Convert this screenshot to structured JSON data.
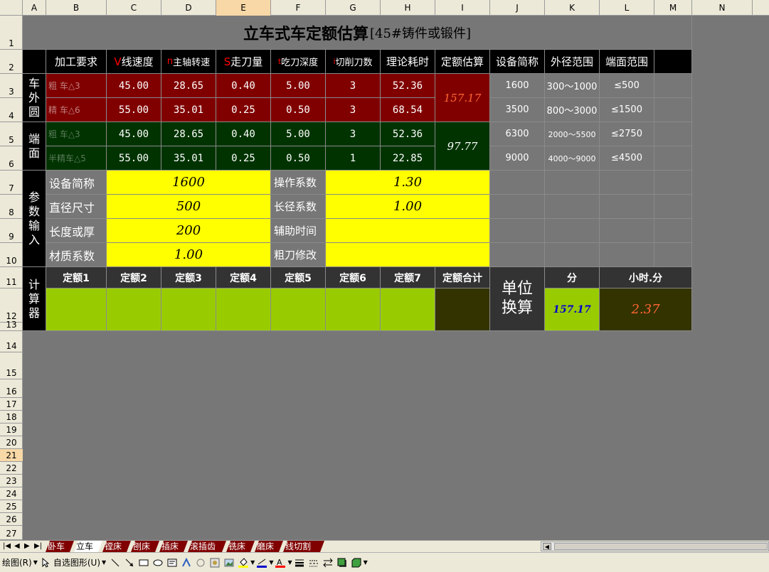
{
  "columns": [
    "A",
    "B",
    "C",
    "D",
    "E",
    "F",
    "G",
    "H",
    "I",
    "J",
    "K",
    "L",
    "M",
    "N"
  ],
  "rows": [
    "1",
    "2",
    "3",
    "4",
    "5",
    "6",
    "7",
    "8",
    "9",
    "10",
    "11",
    "12",
    "13",
    "14",
    "15",
    "16",
    "17",
    "18",
    "19",
    "20",
    "21",
    "22",
    "23",
    "24",
    "25",
    "26",
    "27"
  ],
  "selected_column": "E",
  "selected_row": "21",
  "title": {
    "main": "立车式车定额估算",
    "bracket": "[45#铸件或锻件]"
  },
  "headers": {
    "jiagong": "加工要求",
    "v_prefix": "V",
    "v_rest": "线速度",
    "n_prefix": "n",
    "n_rest": "主轴转速",
    "s_prefix": "S",
    "s_rest": "走刀量",
    "t_prefix": "t",
    "t_rest": "吃刀深度",
    "i_prefix": "i",
    "i_rest": "切削刀数",
    "lilun": "理论耗时",
    "dinge": "定额估算",
    "shebei": "设备简称",
    "waijing": "外径范围",
    "duanmian": "端面范围"
  },
  "section_labels": {
    "outer": [
      "车",
      "外",
      "圆"
    ],
    "face": [
      "端",
      "面"
    ],
    "params": [
      "参",
      "数",
      "输",
      "入"
    ],
    "calc": [
      "计",
      "算",
      "器"
    ]
  },
  "outer_rows": [
    {
      "label": "粗    车△3",
      "v": "45.00",
      "n": "28.65",
      "s": "0.40",
      "t": "5.00",
      "i": "3",
      "time": "52.36"
    },
    {
      "label": "精    车△6",
      "v": "55.00",
      "n": "35.01",
      "s": "0.25",
      "t": "0.50",
      "i": "3",
      "time": "68.54"
    }
  ],
  "outer_estimate": "157.17",
  "face_rows": [
    {
      "label": "粗    车△3",
      "v": "45.00",
      "n": "28.65",
      "s": "0.40",
      "t": "5.00",
      "i": "3",
      "time": "52.36"
    },
    {
      "label": "半精车△5",
      "v": "55.00",
      "n": "35.01",
      "s": "0.25",
      "t": "0.50",
      "i": "1",
      "time": "22.85"
    }
  ],
  "face_estimate": "97.77",
  "equipment_table": [
    {
      "code": "1600",
      "outer": "300～1000",
      "face": "≤500"
    },
    {
      "code": "3500",
      "outer": "800～3000",
      "face": "≤1500"
    },
    {
      "code": "6300",
      "outer": "2000～5500",
      "face": "≤2750"
    },
    {
      "code": "9000",
      "outer": "4000～9000",
      "face": "≤4500"
    }
  ],
  "params": {
    "equip_label": "设备简称",
    "equip_value": "1600",
    "dia_label": "直径尺寸",
    "dia_value": "500",
    "len_label": "长度或厚",
    "len_value": "200",
    "mat_label": "材质系数",
    "mat_value": "1.00",
    "op_label": "操作系数",
    "op_value": "1.30",
    "ld_label": "长径系数",
    "ld_value": "1.00",
    "aux_label": "辅助时间",
    "aux_value": "",
    "rough_label": "粗刀修改",
    "rough_value": ""
  },
  "calc": {
    "headers": [
      "定额1",
      "定额2",
      "定额3",
      "定额4",
      "定额5",
      "定额6",
      "定额7"
    ],
    "total_label": "定额合计",
    "unit_label": [
      "单位",
      "换算"
    ],
    "fen_label": "分",
    "hour_label": "小时.分",
    "fen_value": "157.17",
    "hour_value": "2.37"
  },
  "tabs": [
    "卧车",
    "立车",
    "镗床",
    "刨床",
    "插床",
    "滚插齿",
    "铣床",
    "磨床",
    "线切割"
  ],
  "active_tab": "立车",
  "toolbar": {
    "draw": "绘图(R)",
    "autoshape": "自选图形(U)"
  },
  "colors": {
    "dark_red": "#800000",
    "dark_green": "#003300",
    "yellow": "#ffff00",
    "lime": "#99cc00",
    "olive": "#333300",
    "estimate_red": "#ff6633",
    "fen_blue": "#0000cc",
    "hour_orange": "#ff6633",
    "prefix_red": "#ff0000"
  }
}
